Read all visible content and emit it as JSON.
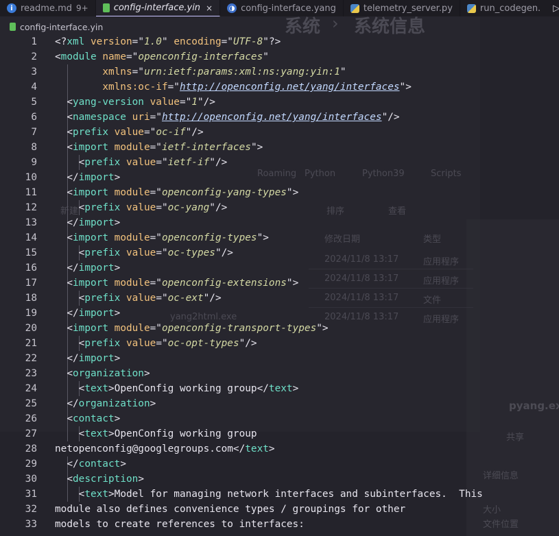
{
  "tabs": [
    {
      "label": "readme.md",
      "badge": "9+",
      "icon": "info-icon",
      "active": false
    },
    {
      "label": "config-interface.yin",
      "icon": "yin-file-icon",
      "active": true
    },
    {
      "label": "config-interface.yang",
      "icon": "yang-file-icon",
      "active": false
    },
    {
      "label": "telemetry_server.py",
      "icon": "python-file-icon",
      "active": false
    },
    {
      "label": "run_codegen.",
      "icon": "python-file-icon",
      "active": false
    }
  ],
  "tab_close": "×",
  "run_button": "▷",
  "breadcrumb": {
    "file": "config-interface.yin"
  },
  "line_numbers": [
    "1",
    "2",
    "3",
    "4",
    "5",
    "6",
    "7",
    "8",
    "9",
    "10",
    "11",
    "12",
    "13",
    "14",
    "15",
    "16",
    "17",
    "18",
    "19",
    "20",
    "21",
    "22",
    "23",
    "24",
    "25",
    "26",
    "27",
    "28",
    "29",
    "30",
    "31",
    "32",
    "33"
  ],
  "code_lines": [
    [
      [
        "p",
        "<?"
      ],
      [
        "t",
        "xml"
      ],
      [
        "p",
        " "
      ],
      [
        "a",
        "version"
      ],
      [
        "p",
        "=\""
      ],
      [
        "v",
        "1.0"
      ],
      [
        "p",
        "\" "
      ],
      [
        "a",
        "encoding"
      ],
      [
        "p",
        "=\""
      ],
      [
        "v",
        "UTF-8"
      ],
      [
        "p",
        "\"?>"
      ]
    ],
    [
      [
        "p",
        "<"
      ],
      [
        "t",
        "module"
      ],
      [
        "p",
        " "
      ],
      [
        "a",
        "name"
      ],
      [
        "p",
        "=\""
      ],
      [
        "v",
        "openconfig-interfaces"
      ],
      [
        "p",
        "\""
      ]
    ],
    [
      [
        "p",
        "        "
      ],
      [
        "a",
        "xmlns"
      ],
      [
        "p",
        "=\""
      ],
      [
        "v",
        "urn:ietf:params:xml:ns:yang:yin:1"
      ],
      [
        "p",
        "\""
      ]
    ],
    [
      [
        "p",
        "        "
      ],
      [
        "a",
        "xmlns:oc-if"
      ],
      [
        "p",
        "=\""
      ],
      [
        "u",
        "http://openconfig.net/yang/interfaces"
      ],
      [
        "p",
        "\">"
      ]
    ],
    [
      [
        "p",
        "  <"
      ],
      [
        "t",
        "yang-version"
      ],
      [
        "p",
        " "
      ],
      [
        "a",
        "value"
      ],
      [
        "p",
        "=\""
      ],
      [
        "v",
        "1"
      ],
      [
        "p",
        "\"/>"
      ]
    ],
    [
      [
        "p",
        "  <"
      ],
      [
        "t",
        "namespace"
      ],
      [
        "p",
        " "
      ],
      [
        "a",
        "uri"
      ],
      [
        "p",
        "=\""
      ],
      [
        "u",
        "http://openconfig.net/yang/interfaces"
      ],
      [
        "p",
        "\"/>"
      ]
    ],
    [
      [
        "p",
        "  <"
      ],
      [
        "t",
        "prefix"
      ],
      [
        "p",
        " "
      ],
      [
        "a",
        "value"
      ],
      [
        "p",
        "=\""
      ],
      [
        "v",
        "oc-if"
      ],
      [
        "p",
        "\"/>"
      ]
    ],
    [
      [
        "p",
        "  <"
      ],
      [
        "t",
        "import"
      ],
      [
        "p",
        " "
      ],
      [
        "a",
        "module"
      ],
      [
        "p",
        "=\""
      ],
      [
        "v",
        "ietf-interfaces"
      ],
      [
        "p",
        "\">"
      ]
    ],
    [
      [
        "p",
        "    <"
      ],
      [
        "t",
        "prefix"
      ],
      [
        "p",
        " "
      ],
      [
        "a",
        "value"
      ],
      [
        "p",
        "=\""
      ],
      [
        "v",
        "ietf-if"
      ],
      [
        "p",
        "\"/>"
      ]
    ],
    [
      [
        "p",
        "  </"
      ],
      [
        "t",
        "import"
      ],
      [
        "p",
        ">"
      ]
    ],
    [
      [
        "p",
        "  <"
      ],
      [
        "t",
        "import"
      ],
      [
        "p",
        " "
      ],
      [
        "a",
        "module"
      ],
      [
        "p",
        "=\""
      ],
      [
        "v",
        "openconfig-yang-types"
      ],
      [
        "p",
        "\">"
      ]
    ],
    [
      [
        "p",
        "    <"
      ],
      [
        "t",
        "prefix"
      ],
      [
        "p",
        " "
      ],
      [
        "a",
        "value"
      ],
      [
        "p",
        "=\""
      ],
      [
        "v",
        "oc-yang"
      ],
      [
        "p",
        "\"/>"
      ]
    ],
    [
      [
        "p",
        "  </"
      ],
      [
        "t",
        "import"
      ],
      [
        "p",
        ">"
      ]
    ],
    [
      [
        "p",
        "  <"
      ],
      [
        "t",
        "import"
      ],
      [
        "p",
        " "
      ],
      [
        "a",
        "module"
      ],
      [
        "p",
        "=\""
      ],
      [
        "v",
        "openconfig-types"
      ],
      [
        "p",
        "\">"
      ]
    ],
    [
      [
        "p",
        "    <"
      ],
      [
        "t",
        "prefix"
      ],
      [
        "p",
        " "
      ],
      [
        "a",
        "value"
      ],
      [
        "p",
        "=\""
      ],
      [
        "v",
        "oc-types"
      ],
      [
        "p",
        "\"/>"
      ]
    ],
    [
      [
        "p",
        "  </"
      ],
      [
        "t",
        "import"
      ],
      [
        "p",
        ">"
      ]
    ],
    [
      [
        "p",
        "  <"
      ],
      [
        "t",
        "import"
      ],
      [
        "p",
        " "
      ],
      [
        "a",
        "module"
      ],
      [
        "p",
        "=\""
      ],
      [
        "v",
        "openconfig-extensions"
      ],
      [
        "p",
        "\">"
      ]
    ],
    [
      [
        "p",
        "    <"
      ],
      [
        "t",
        "prefix"
      ],
      [
        "p",
        " "
      ],
      [
        "a",
        "value"
      ],
      [
        "p",
        "=\""
      ],
      [
        "v",
        "oc-ext"
      ],
      [
        "p",
        "\"/>"
      ]
    ],
    [
      [
        "p",
        "  </"
      ],
      [
        "t",
        "import"
      ],
      [
        "p",
        ">"
      ]
    ],
    [
      [
        "p",
        "  <"
      ],
      [
        "t",
        "import"
      ],
      [
        "p",
        " "
      ],
      [
        "a",
        "module"
      ],
      [
        "p",
        "=\""
      ],
      [
        "v",
        "openconfig-transport-types"
      ],
      [
        "p",
        "\">"
      ]
    ],
    [
      [
        "p",
        "    <"
      ],
      [
        "t",
        "prefix"
      ],
      [
        "p",
        " "
      ],
      [
        "a",
        "value"
      ],
      [
        "p",
        "=\""
      ],
      [
        "v",
        "oc-opt-types"
      ],
      [
        "p",
        "\"/>"
      ]
    ],
    [
      [
        "p",
        "  </"
      ],
      [
        "t",
        "import"
      ],
      [
        "p",
        ">"
      ]
    ],
    [
      [
        "p",
        "  <"
      ],
      [
        "t",
        "organization"
      ],
      [
        "p",
        ">"
      ]
    ],
    [
      [
        "p",
        "    <"
      ],
      [
        "t",
        "text"
      ],
      [
        "p",
        ">"
      ],
      [
        "x",
        "OpenConfig working group"
      ],
      [
        "p",
        "</"
      ],
      [
        "t",
        "text"
      ],
      [
        "p",
        ">"
      ]
    ],
    [
      [
        "p",
        "  </"
      ],
      [
        "t",
        "organization"
      ],
      [
        "p",
        ">"
      ]
    ],
    [
      [
        "p",
        "  <"
      ],
      [
        "t",
        "contact"
      ],
      [
        "p",
        ">"
      ]
    ],
    [
      [
        "p",
        "    <"
      ],
      [
        "t",
        "text"
      ],
      [
        "p",
        ">"
      ],
      [
        "x",
        "OpenConfig working group"
      ]
    ],
    [
      [
        "x",
        "netopenconfig@googlegroups.com"
      ],
      [
        "p",
        "</"
      ],
      [
        "t",
        "text"
      ],
      [
        "p",
        ">"
      ]
    ],
    [
      [
        "p",
        "  </"
      ],
      [
        "t",
        "contact"
      ],
      [
        "p",
        ">"
      ]
    ],
    [
      [
        "p",
        "  <"
      ],
      [
        "t",
        "description"
      ],
      [
        "p",
        ">"
      ]
    ],
    [
      [
        "p",
        "    <"
      ],
      [
        "t",
        "text"
      ],
      [
        "p",
        ">"
      ],
      [
        "x",
        "Model for managing network interfaces and subinterfaces.  This"
      ]
    ],
    [
      [
        "x",
        "module also defines convenience types / groupings for other"
      ]
    ],
    [
      [
        "x",
        "models to create references to interfaces:"
      ]
    ]
  ],
  "indent_guides": [
    0,
    0,
    1,
    1,
    1,
    1,
    1,
    1,
    2,
    1,
    1,
    2,
    1,
    1,
    2,
    1,
    1,
    2,
    1,
    1,
    2,
    1,
    1,
    2,
    1,
    1,
    2,
    0,
    1,
    1,
    2,
    0,
    0
  ],
  "background_ghost_text": [
    "系统",
    "›",
    "系统信息",
    "pyang.exe",
    "共享",
    "详细信息",
    "大小",
    "文件位置",
    "修改日期",
    "类型",
    "2024/11/8 13:17",
    "应用程序",
    "文件",
    "Roaming",
    "Python",
    "Python39",
    "Scripts",
    "排序",
    "查看",
    "新建",
    "yang2html.exe"
  ]
}
